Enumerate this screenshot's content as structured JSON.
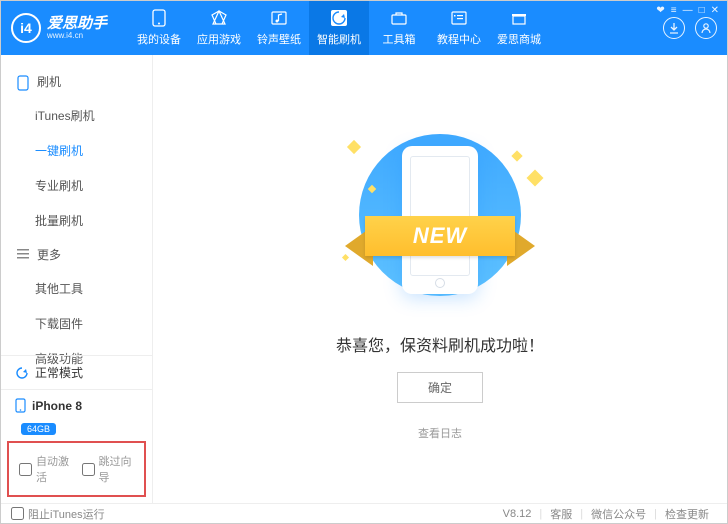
{
  "app": {
    "name": "爱思助手",
    "url": "www.i4.cn",
    "logo": "i4"
  },
  "tabs": [
    {
      "label": "我的设备",
      "icon": "device"
    },
    {
      "label": "应用游戏",
      "icon": "apps"
    },
    {
      "label": "铃声壁纸",
      "icon": "music"
    },
    {
      "label": "智能刷机",
      "icon": "flash",
      "active": true
    },
    {
      "label": "工具箱",
      "icon": "toolbox"
    },
    {
      "label": "教程中心",
      "icon": "book"
    },
    {
      "label": "爱思商城",
      "icon": "store"
    }
  ],
  "win": {
    "skin": "❤",
    "menu": "≡",
    "min": "—",
    "max": "□",
    "close": "✕"
  },
  "sidebar": {
    "sections": [
      {
        "title": "刷机",
        "icon": "phone-outline",
        "items": [
          {
            "label": "iTunes刷机"
          },
          {
            "label": "一键刷机",
            "active": true
          },
          {
            "label": "专业刷机"
          },
          {
            "label": "批量刷机"
          }
        ]
      },
      {
        "title": "更多",
        "icon": "lines",
        "items": [
          {
            "label": "其他工具"
          },
          {
            "label": "下载固件"
          },
          {
            "label": "高级功能"
          }
        ]
      }
    ],
    "mode": {
      "label": "正常模式",
      "icon": "refresh"
    },
    "device": {
      "name": "iPhone 8",
      "capacity": "64GB",
      "icon": "phone-small"
    },
    "auto": {
      "activate": "自动激活",
      "skip": "跳过向导"
    }
  },
  "main": {
    "banner_text": "NEW",
    "success_text": "恭喜您，保资料刷机成功啦！",
    "ok_label": "确定",
    "log_label": "查看日志"
  },
  "footer": {
    "block_itunes": "阻止iTunes运行",
    "version": "V8.12",
    "support": "客服",
    "wechat": "微信公众号",
    "update": "检查更新"
  }
}
